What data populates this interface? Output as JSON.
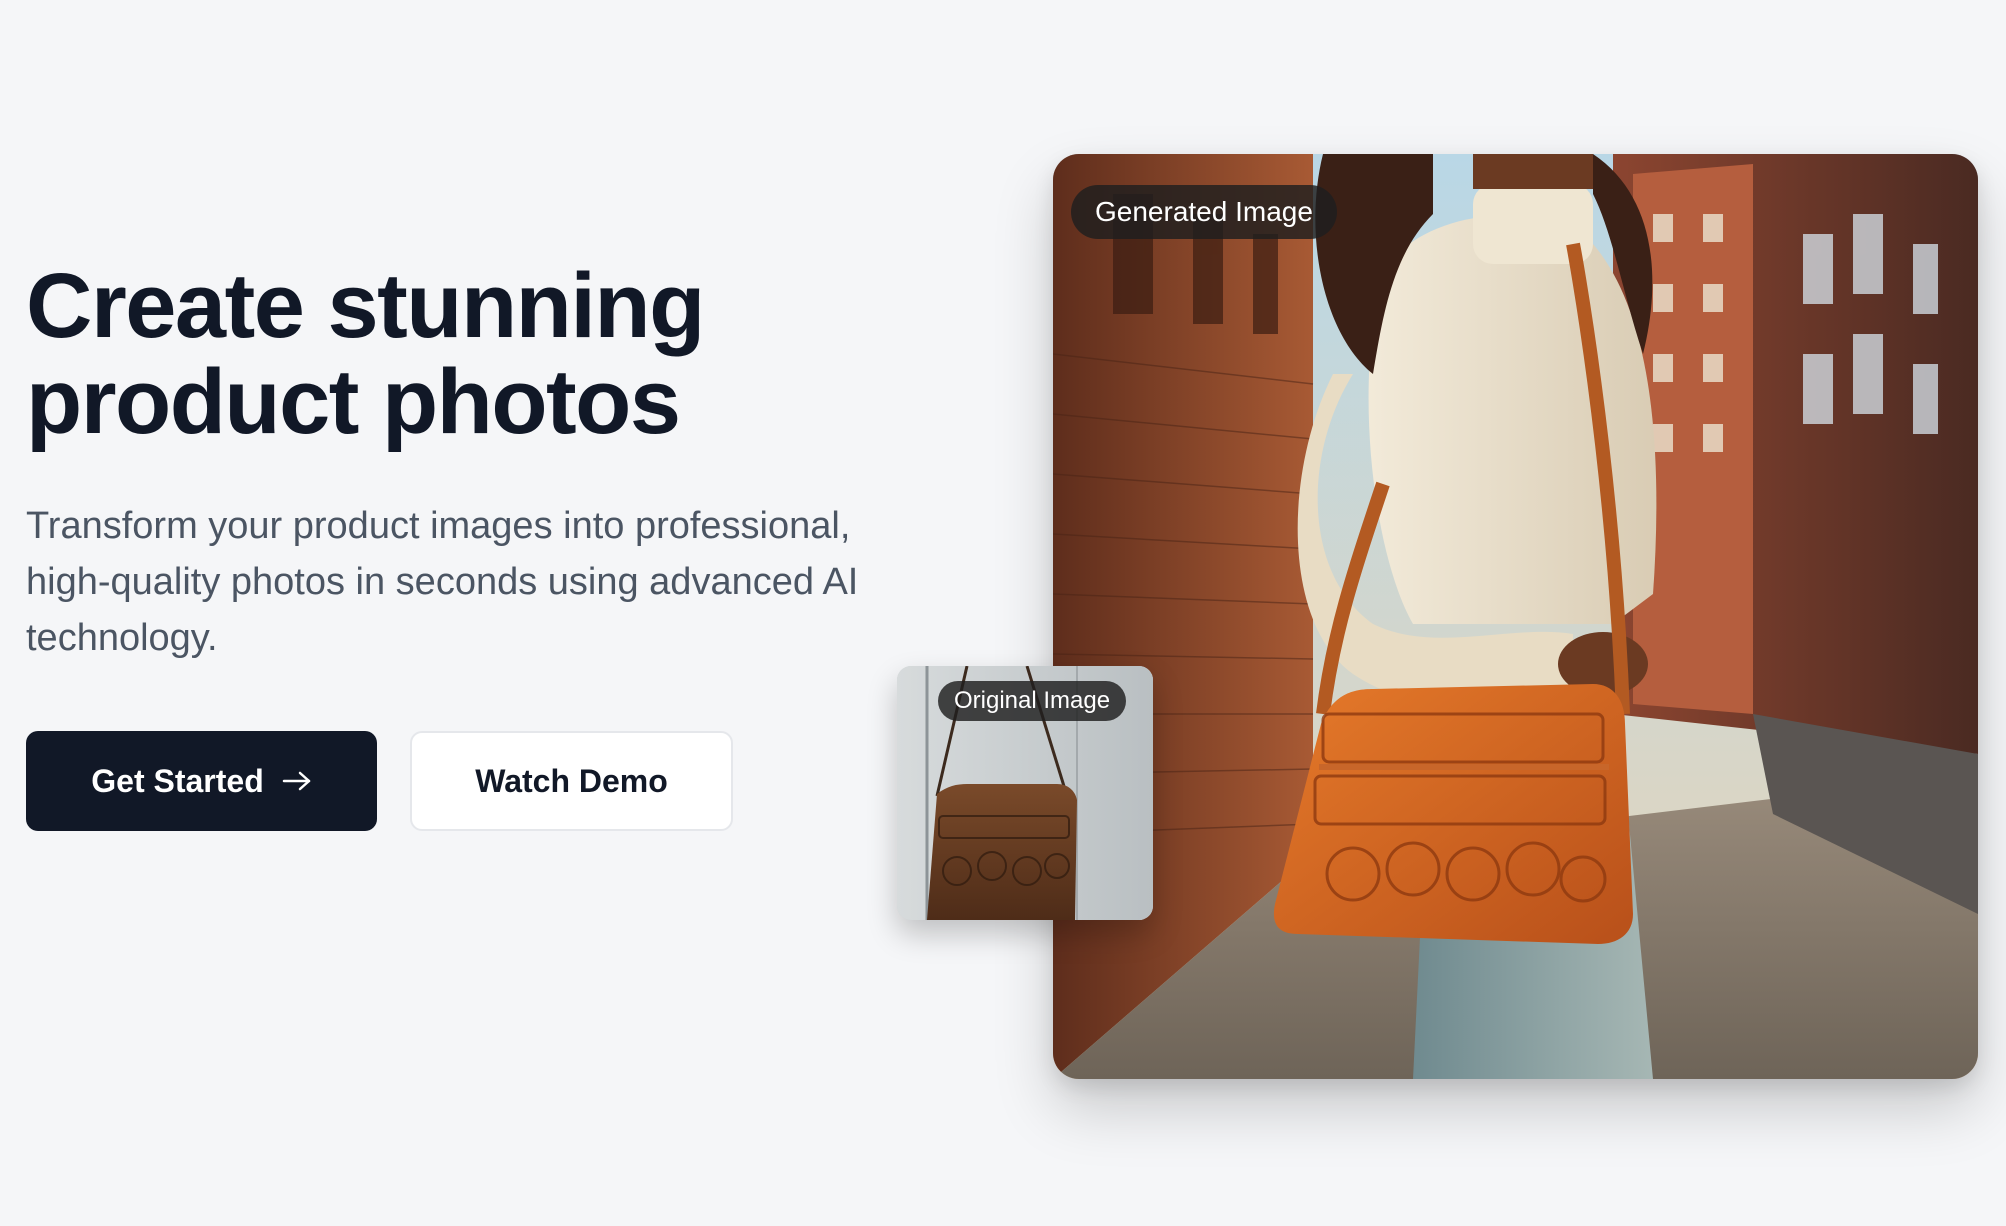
{
  "hero": {
    "headline_line1": "Create stunning",
    "headline_line2": "product photos",
    "subtext": "Transform your product images into professional, high-quality photos in seconds using advanced AI technology."
  },
  "buttons": {
    "primary_label": "Get Started",
    "secondary_label": "Watch Demo"
  },
  "images": {
    "generated_label": "Generated Image",
    "original_label": "Original Image"
  },
  "icons": {
    "primary_button_icon": "arrow-right-icon"
  },
  "colors": {
    "background": "#f5f6f8",
    "headline": "#111827",
    "subtext": "#4b5563",
    "primary_button": "#111827",
    "secondary_button": "#ffffff",
    "badge": "#1f1f1f"
  }
}
